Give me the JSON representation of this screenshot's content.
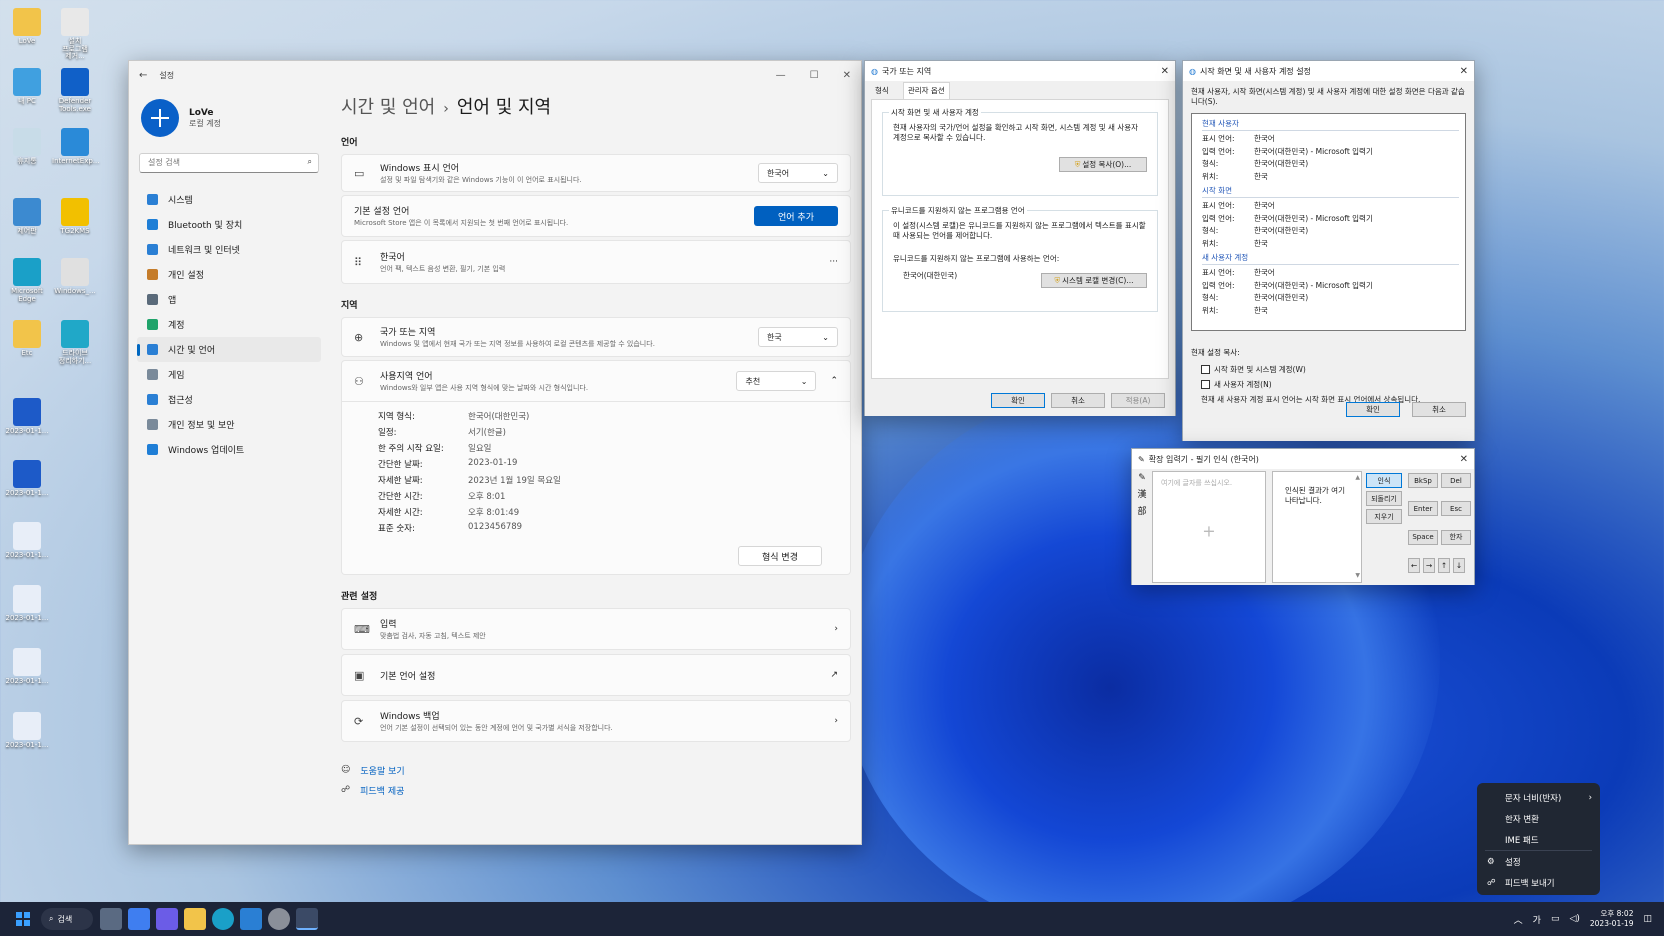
{
  "desktop": {
    "icons": [
      {
        "label": "LoVe",
        "color": "#f2c44a"
      },
      {
        "label": "설치\n프로그램\n제거...",
        "color": "#e8e8e8"
      },
      {
        "label": "내 PC",
        "color": "#40a0e0"
      },
      {
        "label": "Defender\nTools.exe",
        "color": "#1060c8"
      },
      {
        "label": "휴지통",
        "color": "#c8dce8"
      },
      {
        "label": "InternetExp...",
        "color": "#2a8ad8"
      },
      {
        "label": "제어판",
        "color": "#3c8ad0"
      },
      {
        "label": "TG2KMS",
        "color": "#f2c000"
      },
      {
        "label": "Microsoft\nEdge",
        "color": "#1aa0c8"
      },
      {
        "label": "Windows_...",
        "color": "#e0e0e0"
      },
      {
        "label": "Etc",
        "color": "#f2c44a"
      },
      {
        "label": "드라이브\n정리하기...",
        "color": "#20a8c8"
      },
      {
        "label": "2023-01-1...",
        "color": "#1d5ac8"
      },
      {
        "label": "2023-01-1...",
        "color": "#1d5ac8"
      },
      {
        "label": "2023-01-1...",
        "color": "#e8eef8"
      },
      {
        "label": "2023-01-1...",
        "color": "#e8eef8"
      },
      {
        "label": "2023-01-1...",
        "color": "#e8eef8"
      },
      {
        "label": "2023-01-1...",
        "color": "#e8eef8"
      }
    ]
  },
  "settings": {
    "window_title": "설정",
    "controls": {
      "min": "—",
      "max": "☐",
      "close": "✕"
    },
    "back_icon": "←",
    "profile": {
      "name": "LoVe",
      "sub": "로컬 계정"
    },
    "search_placeholder": "설정 검색",
    "nav": [
      {
        "label": "시스템",
        "color": "#2a7fd4"
      },
      {
        "label": "Bluetooth 및 장치",
        "color": "#1e7ed6"
      },
      {
        "label": "네트워크 및 인터넷",
        "color": "#2a7fd4"
      },
      {
        "label": "개인 설정",
        "color": "#c57c2a"
      },
      {
        "label": "앱",
        "color": "#5a6a7a"
      },
      {
        "label": "계정",
        "color": "#1fa36a"
      },
      {
        "label": "시간 및 언어",
        "color": "#2a7fd4"
      },
      {
        "label": "게임",
        "color": "#7a8a9a"
      },
      {
        "label": "접근성",
        "color": "#2a7fd4"
      },
      {
        "label": "개인 정보 및 보안",
        "color": "#7a8a9a"
      },
      {
        "label": "Windows 업데이트",
        "color": "#1e7ed6"
      }
    ],
    "breadcrumb": {
      "parent": "시간 및 언어",
      "sep": "›",
      "current": "언어 및 지역"
    },
    "lang_section": "언어",
    "display_lang": {
      "title": "Windows 표시 언어",
      "desc": "설정 및 파일 탐색기와 같은 Windows 기능이 이 언어로 표시됩니다.",
      "value": "한국어"
    },
    "preferred_lang": {
      "title": "기본 설정 언어",
      "desc": "Microsoft Store 앱은 이 목록에서 지원되는 첫 번째 언어로 표시됩니다.",
      "button": "언어 추가"
    },
    "korean": {
      "title": "한국어",
      "desc": "언어 팩, 텍스트 음성 변환, 필기, 기본 입력",
      "more": "···"
    },
    "region_section": "지역",
    "country": {
      "title": "국가 또는 지역",
      "desc": "Windows 및 앱에서 현재 국가 또는 지역 정보를 사용하여 로컬 콘텐츠를 제공할 수 있습니다.",
      "value": "한국"
    },
    "regional_format": {
      "title": "사용지역 언어",
      "desc": "Windows와 일부 앱은 사용 지역 형식에 맞는 날짜와 시간 형식입니다.",
      "value": "추천"
    },
    "format_details": [
      {
        "k": "지역 형식:",
        "v": "한국어(대한민국)"
      },
      {
        "k": "일정:",
        "v": "서기(한글)"
      },
      {
        "k": "한 주의 시작 요일:",
        "v": "일요일"
      },
      {
        "k": "간단한 날짜:",
        "v": "2023-01-19"
      },
      {
        "k": "자세한 날짜:",
        "v": "2023년 1월 19일 목요일"
      },
      {
        "k": "간단한 시간:",
        "v": "오후 8:01"
      },
      {
        "k": "자세한 시간:",
        "v": "오후 8:01:49"
      },
      {
        "k": "표준 숫자:",
        "v": "0123456789"
      }
    ],
    "change_format": "형식 변경",
    "related_section": "관련 설정",
    "related": [
      {
        "title": "입력",
        "desc": "맞춤법 검사, 자동 고침, 텍스트 제안",
        "icon": "⌨",
        "arrow": "›"
      },
      {
        "title": "기본 언어 설정",
        "desc": "",
        "icon": "▣",
        "arrow": "↗"
      },
      {
        "title": "Windows 백업",
        "desc": "언어 기본 설정이 선택되어 있는 동안 계정에 언어 및 국가별 서식을 저장합니다.",
        "icon": "⟳",
        "arrow": "›"
      }
    ],
    "help": "도움말 보기",
    "feedback": "피드백 제공"
  },
  "region_dialog": {
    "title": "국가 또는 지역",
    "tabs": [
      "형식",
      "관리자 옵션"
    ],
    "welcome_group": "시작 화면 및 새 사용자 계정",
    "welcome_text": "현재 사용자의 국가/언어 설정을 확인하고 시작 화면, 시스템 계정 및 새 사용자 계정으로 복사할 수 있습니다.",
    "copy_button": "설정 복사(O)...",
    "unicode_group": "유니코드를 지원하지 않는 프로그램용 언어",
    "unicode_text": "이 설정(시스템 로캘)은 유니코드를 지원하지 않는 프로그램에서 텍스트를 표시할 때 사용되는 언어를 제어합니다.",
    "current_label": "유니코드를 지원하지 않는 프로그램에 사용하는 언어:",
    "current_value": "한국어(대한민국)",
    "change_locale": "시스템 로캘 변경(C)...",
    "ok": "확인",
    "cancel": "취소",
    "apply": "적용(A)"
  },
  "welcome_dialog": {
    "title": "시작 화면 및 새 사용자 계정 설정",
    "intro": "현재 사용자, 시작 화면(시스템 계정) 및 새 사용자 계정에 대한 설정 화면은 다음과 같습니다(S).",
    "sections": [
      {
        "name": "현재 사용자",
        "rows": [
          [
            "표시 언어:",
            "한국어"
          ],
          [
            "입력 언어:",
            "한국어(대한민국) - Microsoft 입력기"
          ],
          [
            "형식:",
            "한국어(대한민국)"
          ],
          [
            "위치:",
            "한국"
          ]
        ]
      },
      {
        "name": "시작 화면",
        "rows": [
          [
            "표시 언어:",
            "한국어"
          ],
          [
            "입력 언어:",
            "한국어(대한민국) - Microsoft 입력기"
          ],
          [
            "형식:",
            "한국어(대한민국)"
          ],
          [
            "위치:",
            "한국"
          ]
        ]
      },
      {
        "name": "새 사용자 계정",
        "rows": [
          [
            "표시 언어:",
            "한국어"
          ],
          [
            "입력 언어:",
            "한국어(대한민국) - Microsoft 입력기"
          ],
          [
            "형식:",
            "한국어(대한민국)"
          ],
          [
            "위치:",
            "한국"
          ]
        ]
      }
    ],
    "copy_label": "현재 설정 복사:",
    "check1": "시작 화면 및 시스템 계정(W)",
    "check2": "새 사용자 계정(N)",
    "note": "현재 새 사용자 계정 표시 언어는 시작 화면 표시 언어에서 상속됩니다.",
    "ok": "확인",
    "cancel": "취소"
  },
  "ime_pad": {
    "title": "확장 입력기 - 필기 인식 (한국어)",
    "left_icons": [
      "✎",
      "漢",
      "部"
    ],
    "placeholder": "여기에 글자를 쓰십시오.",
    "result_hint": "인식된 결과가 여기 나타납니다.",
    "actions": [
      "인식",
      "되돌리기",
      "지우기"
    ],
    "keys": [
      "BkSp",
      "Del",
      "Enter",
      "Esc",
      "Space",
      "한자"
    ],
    "arrows": [
      "←",
      "→",
      "↑",
      "↓"
    ]
  },
  "ime_menu": {
    "items": [
      {
        "label": "문자 너비(반자)",
        "icon": "",
        "arrow": "›"
      },
      {
        "label": "한자 변환",
        "icon": "",
        "arrow": ""
      },
      {
        "label": "IME 패드",
        "icon": "",
        "arrow": ""
      },
      {
        "label": "설정",
        "icon": "⚙",
        "arrow": ""
      },
      {
        "label": "피드백 보내기",
        "icon": "☍",
        "arrow": ""
      }
    ]
  },
  "taskbar": {
    "search": "검색",
    "tray_up": "︿",
    "ime_mode": "가",
    "time": "오후 8:02",
    "date": "2023-01-19"
  }
}
